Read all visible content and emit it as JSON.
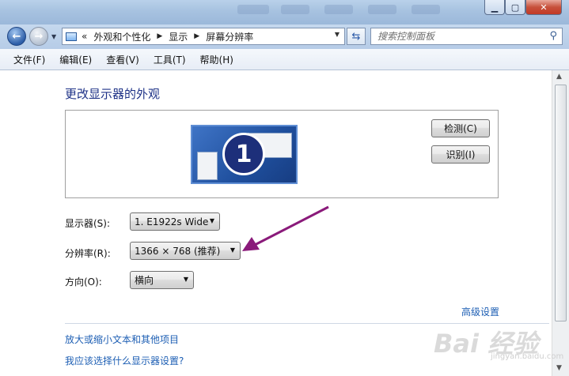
{
  "window": {
    "buttons": {
      "minimize_icon": "minimize-icon",
      "maximize_icon": "maximize-icon",
      "close_icon": "close-icon"
    }
  },
  "navbar": {
    "breadcrumb_prefix": "«",
    "breadcrumbs": [
      "外观和个性化",
      "显示",
      "屏幕分辨率"
    ],
    "search_placeholder": "搜索控制面板"
  },
  "menubar": {
    "items": [
      "文件(F)",
      "编辑(E)",
      "查看(V)",
      "工具(T)",
      "帮助(H)"
    ]
  },
  "main": {
    "title": "更改显示器的外观",
    "monitor_number": "1",
    "detect_label": "检测(C)",
    "identify_label": "识别(I)",
    "display_label": "显示器(S):",
    "display_value": "1. E1922s Wide",
    "resolution_label": "分辨率(R):",
    "resolution_value": "1366 × 768 (推荐)",
    "orientation_label": "方向(O):",
    "orientation_value": "横向",
    "advanced_link": "高级设置",
    "link_text_size": "放大或缩小文本和其他项目",
    "link_which_settings": "我应该选择什么显示器设置?"
  },
  "watermark": {
    "text": "Bai 经验",
    "url": "jingyan.baidu.com"
  },
  "colors": {
    "accent_title": "#1e3287",
    "link": "#1e5fb4",
    "annotation_arrow": "#8a1a7a"
  }
}
